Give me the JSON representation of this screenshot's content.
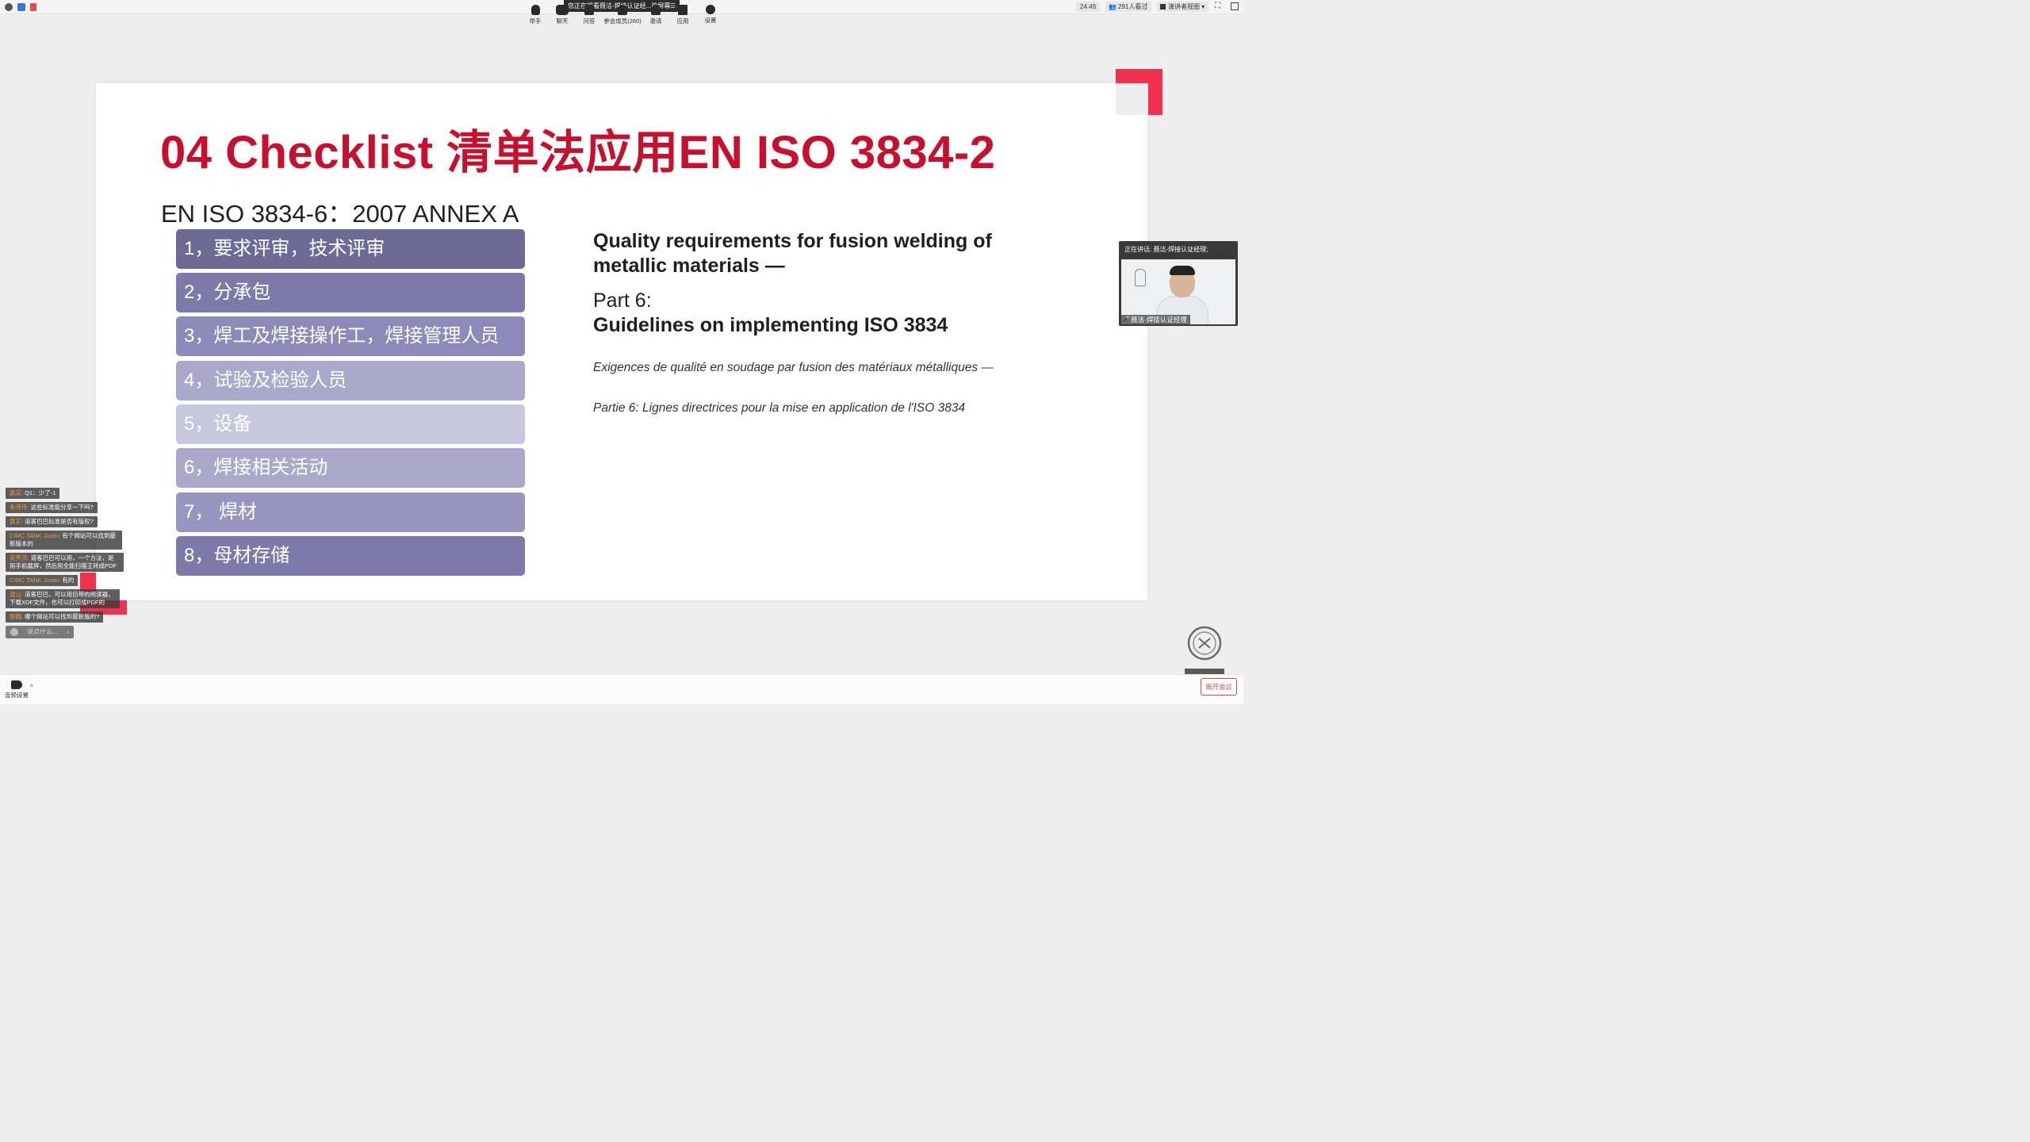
{
  "topbar": {
    "share_banner": "您正在观看聂洁-焊接认证经...的屏幕",
    "timer": "24:49",
    "viewers": "291人看过",
    "view_mode": "演讲者视图"
  },
  "slide": {
    "title": "04  Checklist 清单法应用EN ISO 3834-2",
    "subtitle": "EN ISO 3834-6：2007  ANNEX A",
    "items": [
      {
        "label": "1，要求评审，技术评审",
        "color": "#6e6a96"
      },
      {
        "label": "2，分承包",
        "color": "#7e79a8"
      },
      {
        "label": "3，焊工及焊接操作工，焊接管理人员",
        "color": "#8e89b8"
      },
      {
        "label": "4，试验及检验人员",
        "color": "#aca8cc"
      },
      {
        "label": "5，设备",
        "color": "#c9c6df"
      },
      {
        "label": "6，焊接相关活动",
        "color": "#aca8cc"
      },
      {
        "label": "7， 焊材",
        "color": "#9a95c0"
      },
      {
        "label": "8，母材存储",
        "color": "#7e79a8"
      }
    ],
    "quality_title": "Quality requirements for fusion welding of metallic materials —",
    "part": "Part 6:",
    "guidelines": "Guidelines on implementing ISO 3834",
    "french_title": "Exigences de qualité en soudage par fusion des matériaux métalliques —",
    "french_part": "Partie 6: Lignes directrices pour la mise en application de l'ISO 3834"
  },
  "video": {
    "header": "正在讲话: 聂洁-焊接认证经理;",
    "name": "聂洁-焊接认证经理"
  },
  "chat": {
    "messages": [
      {
        "user": "真实:",
        "text": "Q1：少了-1"
      },
      {
        "user": "朱伟伟:",
        "text": "这些标准能分享一下吗?"
      },
      {
        "user": "真实:",
        "text": "道客巴巴标准是否有版权?"
      },
      {
        "user": "CIMC TANK Justin:",
        "text": "有个网站可以找到最新版本的"
      },
      {
        "user": "吴秀鸿:",
        "text": "道客巴巴可以用，一个方法，是用手机截屏，然后用全能扫描王转成PDF"
      },
      {
        "user": "CIMC TANK Justin:",
        "text": "有的"
      },
      {
        "user": "混山:",
        "text": "道客巴巴，可以用自带的阅读器，下载XDF文件，也可以打印成PDF的"
      },
      {
        "user": "郭翰:",
        "text": "哪个网站可以找到最新版的?"
      }
    ],
    "input_placeholder": "说点什么..."
  },
  "toolbar": {
    "audio": "音频设置",
    "raise_hand": "举手",
    "chat": "聊天",
    "qa": "问答",
    "participants": "参会成员(260)",
    "invite": "邀请",
    "apps": "应用",
    "settings": "设置",
    "leave": "离开会议"
  },
  "colors": {
    "accent_red": "#c8102e",
    "brand_red": "#f0324e"
  }
}
